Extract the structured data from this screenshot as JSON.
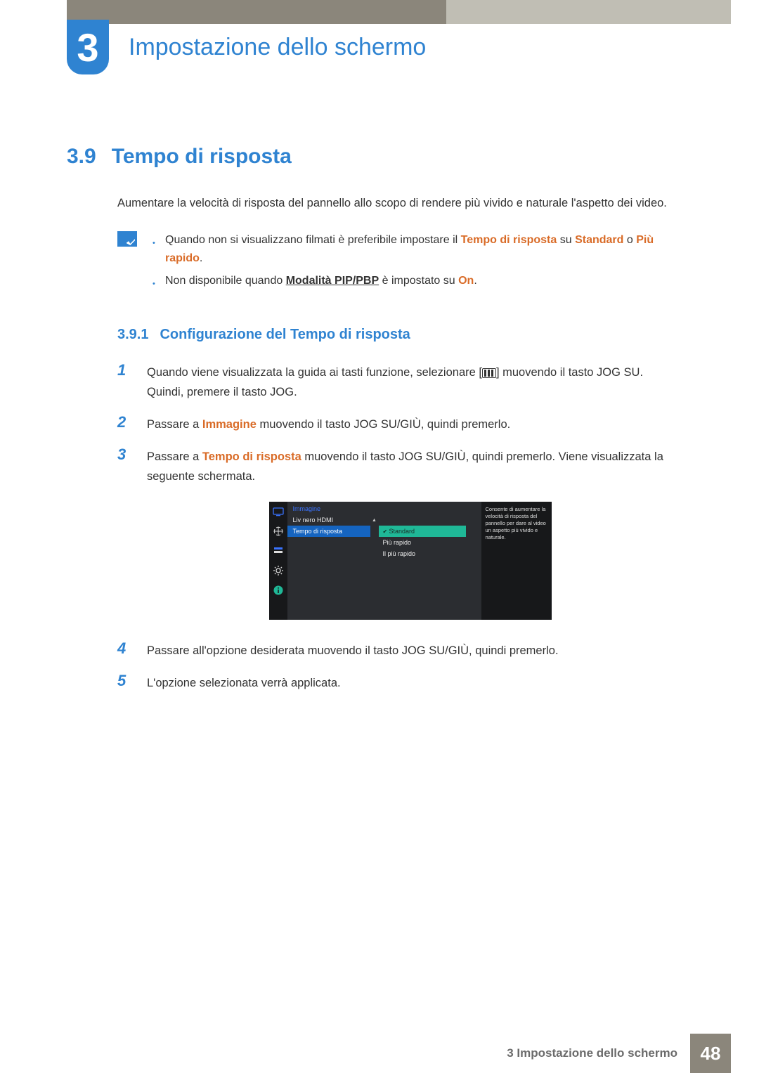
{
  "chapter": {
    "number": "3",
    "title": "Impostazione dello schermo"
  },
  "section": {
    "number": "3.9",
    "title": "Tempo di risposta"
  },
  "intro": "Aumentare la velocità di risposta del pannello allo scopo di rendere più vivido e naturale l'aspetto dei video.",
  "note": {
    "item1": {
      "pre": "Quando non si visualizzano filmati è preferibile impostare il ",
      "bold1": "Tempo di risposta",
      "mid": " su ",
      "bold2": "Standard",
      "or": " o ",
      "bold3": "Più rapido",
      "post": "."
    },
    "item2": {
      "pre": "Non disponibile quando ",
      "link": "Modalità PIP/PBP",
      "mid": " è impostato su ",
      "on": "On",
      "post": "."
    }
  },
  "subsection": {
    "number": "3.9.1",
    "title": "Configurazione del Tempo di risposta"
  },
  "steps": {
    "s1a": "Quando viene visualizzata la guida ai tasti funzione, selezionare [",
    "s1b": "] muovendo il tasto JOG SU. Quindi, premere il tasto JOG.",
    "s2a": "Passare a ",
    "s2bold": "Immagine",
    "s2b": " muovendo il tasto JOG SU/GIÙ, quindi premerlo.",
    "s3a": "Passare a ",
    "s3bold": "Tempo di risposta",
    "s3b": " muovendo il tasto JOG SU/GIÙ, quindi premerlo. Viene visualizzata la seguente schermata.",
    "s4": "Passare all'opzione desiderata muovendo il tasto JOG SU/GIÙ, quindi premerlo.",
    "s5": "L'opzione selezionata verrà applicata."
  },
  "osd": {
    "category": "Immagine",
    "rows": {
      "r1": "Liv nero HDMI",
      "r2": "Tempo di risposta"
    },
    "options": {
      "o1": "Standard",
      "o2": "Più rapido",
      "o3": "Il più rapido"
    },
    "help": "Consente di aumentare la velocità di risposta del pannello per dare al video un aspetto più vivido e naturale."
  },
  "footer": {
    "text": "3 Impostazione dello schermo",
    "page": "48"
  }
}
